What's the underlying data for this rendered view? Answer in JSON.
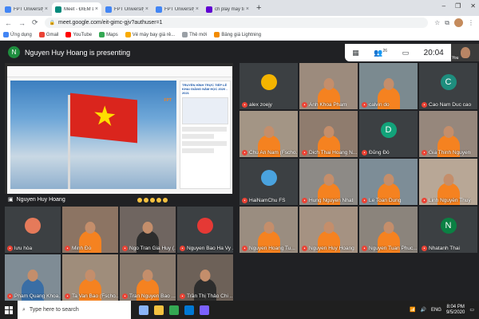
{
  "browser": {
    "tabs": [
      {
        "label": "FPT University - Calendar - Satu",
        "favicon_color": "#4285f4",
        "active": false
      },
      {
        "label": "Meet - ĐIỂM DANH XEM LỄ",
        "favicon_color": "#00897b",
        "active": true
      },
      {
        "label": "FPT University - Calendar - Satu",
        "favicon_color": "#4285f4",
        "active": false
      },
      {
        "label": "FPT University - Calendar - Satu",
        "favicon_color": "#4285f4",
        "active": false
      },
      {
        "label": "ch play may tinh - Yahoo Search",
        "favicon_color": "#6001d2",
        "active": false
      }
    ],
    "new_tab": "+",
    "close_glyph": "×",
    "window_controls": [
      "–",
      "❐",
      "✕"
    ],
    "nav": {
      "back": "←",
      "forward": "→",
      "reload": "⟳"
    },
    "url": "meet.google.com/eit-gimc-gjv?authuser=1",
    "bookmarks": [
      {
        "label": "Ứng dụng",
        "color": "#4285f4"
      },
      {
        "label": "Gmail",
        "color": "#ea4335"
      },
      {
        "label": "YouTube",
        "color": "#ff0000"
      },
      {
        "label": "Maps",
        "color": "#34a853"
      },
      {
        "label": "Vé máy bay giá rẻ...",
        "color": "#f9ab00"
      },
      {
        "label": "Thẻ mới",
        "color": "#9aa0a6"
      },
      {
        "label": "Bảng giá Lightning",
        "color": "#f28b00"
      }
    ]
  },
  "meet": {
    "presenter_initial": "N",
    "presenting_text": "Nguyen Huy Hoang is presenting",
    "presentation_name": "Nguyen Huy Hoang",
    "presentation_doc_title": "TRUYỀN HÌNH TRỰC TIẾP LỄ KHAI GIẢNG NĂM HỌC 2020 - 2021",
    "participant_count": "26",
    "clock": "20:04",
    "self_label": "You"
  },
  "participants": [
    {
      "name": "alex zoejy",
      "initial": "",
      "bg": "#3c4043",
      "pic": "#f4b400",
      "person": false
    },
    {
      "name": "Anh Khoa Pham",
      "initial": "",
      "bg": "#9c8b7d",
      "pic": "",
      "person": true,
      "shirt": "#f58220"
    },
    {
      "name": "calvin do",
      "initial": "",
      "bg": "#7b8a90",
      "pic": "",
      "person": true,
      "shirt": "#f58220"
    },
    {
      "name": "Cao Nam Duc cao",
      "initial": "C",
      "bg": "#3c4043",
      "pic": "#1e8e7e",
      "person": false
    },
    {
      "name": "Chu An Nam (Fscho...",
      "initial": "",
      "bg": "#a39585",
      "pic": "",
      "person": true,
      "shirt": "#f58220"
    },
    {
      "name": "Dich Thai Hoang N...",
      "initial": "",
      "bg": "#8f7c6e",
      "pic": "",
      "person": true,
      "shirt": "#f58220"
    },
    {
      "name": "Đũng Đỗ",
      "initial": "D",
      "bg": "#3c4043",
      "pic": "#12a37a",
      "person": false
    },
    {
      "name": "Gia Thinh Nguyen",
      "initial": "",
      "bg": "#96877c",
      "pic": "",
      "person": true,
      "shirt": "#f58220"
    },
    {
      "name": "HaiNamChu FS",
      "initial": "",
      "bg": "#3c4043",
      "pic": "#4aa3df",
      "person": false
    },
    {
      "name": "Hung Nguyen Nhat",
      "initial": "",
      "bg": "#8d8a86",
      "pic": "",
      "person": true,
      "shirt": "#f58220"
    },
    {
      "name": "Le Toan Dung",
      "initial": "",
      "bg": "#7d8d97",
      "pic": "",
      "person": true,
      "shirt": "#f58220"
    },
    {
      "name": "Linh Nguyễn Thuỳ",
      "initial": "",
      "bg": "#b8a796",
      "pic": "",
      "person": true,
      "shirt": "#f58220"
    },
    {
      "name": "lưu hòa",
      "initial": "",
      "bg": "#3c4043",
      "pic": "#e57a5a",
      "person": false
    },
    {
      "name": "Minh Đỗ",
      "initial": "",
      "bg": "#8c7463",
      "pic": "",
      "person": true,
      "shirt": "#f58220"
    },
    {
      "name": "Ngo Tran Gia Huy (...",
      "initial": "",
      "bg": "#6f6560",
      "pic": "",
      "person": true,
      "shirt": "#2d2d2d"
    },
    {
      "name": "Nguyen Bao Ha Vy ...",
      "initial": "",
      "bg": "#3c4043",
      "pic": "#e53935",
      "person": false
    },
    {
      "name": "Nguyen Hoang Tu...",
      "initial": "",
      "bg": "#9a8d80",
      "pic": "",
      "person": true,
      "shirt": "#f58220"
    },
    {
      "name": "Nguyen Huy Hoang",
      "initial": "",
      "bg": "#a59282",
      "pic": "",
      "person": true,
      "shirt": "#f58220"
    },
    {
      "name": "Nguyen Tuan Phuc...",
      "initial": "",
      "bg": "#8b847c",
      "pic": "",
      "person": true,
      "shirt": "#f58220"
    },
    {
      "name": "Nhatanh Thai",
      "initial": "N",
      "bg": "#3c4043",
      "pic": "#0b8043",
      "person": false
    },
    {
      "name": "Pham Quang Khoa...",
      "initial": "",
      "bg": "#7f8c95",
      "pic": "",
      "person": true,
      "shirt": "#3a6ea5"
    },
    {
      "name": "Ta Van Bao (Fscho...",
      "initial": "",
      "bg": "#9f8d7b",
      "pic": "",
      "person": true,
      "shirt": "#f58220"
    },
    {
      "name": "Tran Nguyen Bao ...",
      "initial": "",
      "bg": "#8a7b6e",
      "pic": "",
      "person": true,
      "shirt": "#f58220"
    },
    {
      "name": "Trần Thị Thảo Chi ...",
      "initial": "",
      "bg": "#6d6158",
      "pic": "",
      "person": true,
      "shirt": "#2d2d2d"
    }
  ],
  "taskbar": {
    "search_placeholder": "Type here to search",
    "language": "ENG",
    "time": "8:04 PM",
    "date": "9/5/2020"
  }
}
